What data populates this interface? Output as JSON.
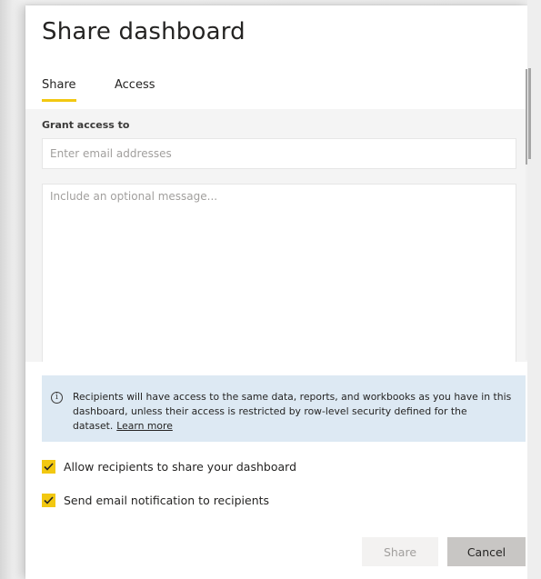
{
  "dialog": {
    "title": "Share dashboard",
    "tabs": [
      {
        "label": "Share",
        "active": true
      },
      {
        "label": "Access",
        "active": false
      }
    ],
    "grant_label": "Grant access to",
    "email_placeholder": "Enter email addresses",
    "message_placeholder": "Include an optional message...",
    "info": {
      "icon": "info-icon",
      "icon_glyph": "i",
      "text": "Recipients will have access to the same data, reports, and workbooks as you have in this dashboard, unless their access is restricted by row-level security defined for the dataset.",
      "link": "Learn more"
    },
    "checkboxes": [
      {
        "label": "Allow recipients to share your dashboard",
        "checked": true
      },
      {
        "label": "Send email notification to recipients",
        "checked": true
      }
    ],
    "buttons": {
      "share": "Share",
      "cancel": "Cancel"
    }
  },
  "colors": {
    "accent": "#f2c811",
    "info_bg": "#dde9f3",
    "text": "#252423"
  }
}
